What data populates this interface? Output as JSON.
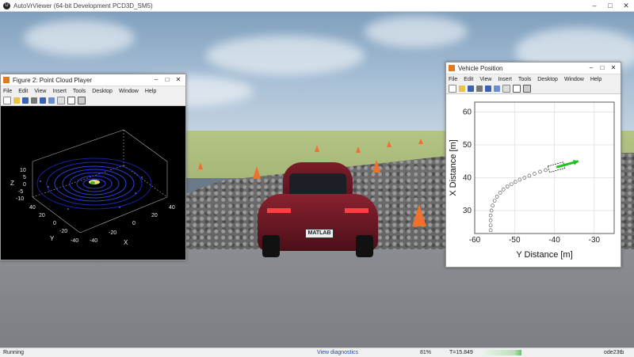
{
  "app": {
    "title": "AutoVrViewer (64-bit Development PCD3D_SM5)",
    "window_controls": [
      "–",
      "□",
      "✕"
    ]
  },
  "scene": {
    "license_plate": "MATLAB"
  },
  "point_cloud_window": {
    "title": "Figure 2: Point Cloud Player",
    "menu": [
      "File",
      "Edit",
      "View",
      "Insert",
      "Tools",
      "Desktop",
      "Window",
      "Help"
    ],
    "axes": {
      "z_label": "Z",
      "y_label": "Y",
      "x_label": "X",
      "z_ticks": [
        "10",
        "5",
        "0",
        "-5",
        "-10"
      ],
      "y_ticks": [
        "40",
        "20",
        "0",
        "-20",
        "-40"
      ],
      "x_ticks": [
        "-40",
        "-20",
        "0",
        "20",
        "40"
      ]
    }
  },
  "vehicle_position_window": {
    "title": "Vehicle Position",
    "menu": [
      "File",
      "Edit",
      "View",
      "Insert",
      "Tools",
      "Desktop",
      "Window",
      "Help"
    ]
  },
  "chart_data": {
    "type": "scatter",
    "xlabel": "Y Distance [m]",
    "ylabel": "X Distance [m]",
    "xlim": [
      -60,
      -25
    ],
    "ylim": [
      23,
      63
    ],
    "xticks": [
      -60,
      -50,
      -40,
      -30
    ],
    "yticks": [
      30,
      40,
      50,
      60
    ],
    "grid": true,
    "series": [
      {
        "marker": "circle",
        "points": [
          [
            -56.0,
            24.0
          ],
          [
            -56.0,
            25.5
          ],
          [
            -56.0,
            27.0
          ],
          [
            -56.0,
            28.5
          ],
          [
            -55.8,
            30.0
          ],
          [
            -55.5,
            31.5
          ],
          [
            -55.0,
            33.0
          ],
          [
            -54.4,
            34.2
          ],
          [
            -53.6,
            35.4
          ],
          [
            -52.8,
            36.4
          ],
          [
            -51.8,
            37.3
          ],
          [
            -50.8,
            38.0
          ],
          [
            -49.8,
            38.7
          ],
          [
            -48.7,
            39.4
          ],
          [
            -47.5,
            40.0
          ],
          [
            -46.3,
            40.6
          ],
          [
            -45.0,
            41.2
          ],
          [
            -43.6,
            41.8
          ],
          [
            -42.2,
            42.3
          ],
          [
            -40.8,
            42.8
          ]
        ]
      }
    ],
    "vehicle": {
      "y": -39.5,
      "x": 43.2,
      "heading_to": [
        -34.0,
        45.0
      ],
      "arrow_color": "#22c022"
    }
  },
  "status": {
    "left": "Running",
    "diagnostics": "View diagnostics",
    "percent": "81%",
    "time": "T=15.849",
    "solver": "ode23tb"
  },
  "colors": {
    "progress_fill": "#5ecb5e",
    "cone": "#f07030",
    "car": "#7a1d29"
  }
}
